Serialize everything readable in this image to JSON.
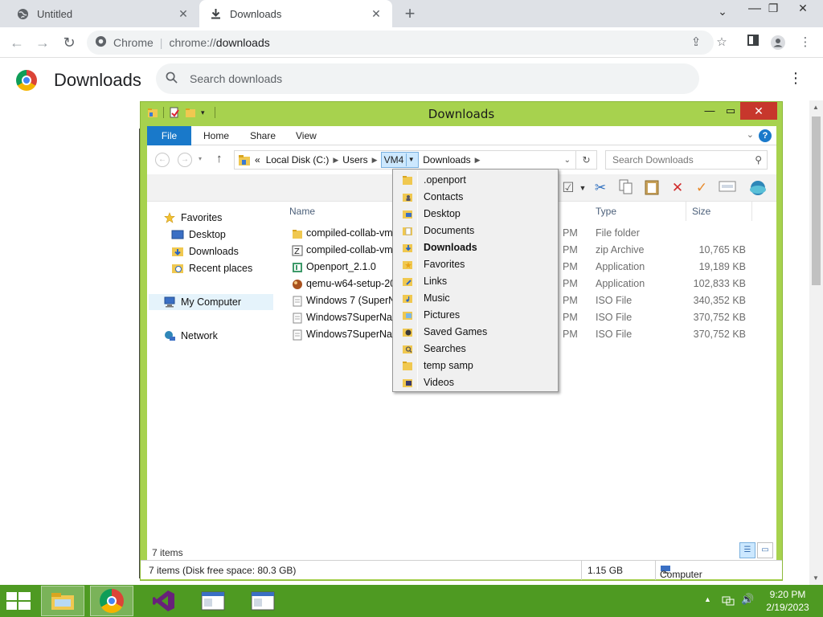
{
  "browser": {
    "tabs": [
      {
        "label": "Untitled",
        "close": "✕"
      },
      {
        "label": "Downloads",
        "close": "✕"
      }
    ],
    "new_tab": "+",
    "window_buttons": {
      "chevron": "⌄",
      "restore": "❐",
      "close": "✕"
    },
    "omnibox": {
      "site": "Chrome",
      "url_prefix": "chrome://",
      "url_host": "downloads"
    }
  },
  "downloads_page": {
    "title": "Downloads",
    "search_placeholder": "Search downloads"
  },
  "explorer": {
    "title": "Downloads",
    "ribbon_tabs": [
      "File",
      "Home",
      "Share",
      "View"
    ],
    "breadcrumb": {
      "prefix": "«",
      "items": [
        "Local Disk (C:)",
        "Users",
        "VM4",
        "Downloads"
      ]
    },
    "search_placeholder": "Search Downloads",
    "nav": {
      "favorites": "Favorites",
      "desktop": "Desktop",
      "downloads": "Downloads",
      "recent": "Recent places",
      "computer": "My Computer",
      "network": "Network"
    },
    "columns": {
      "name": "Name",
      "type": "Type",
      "size": "Size"
    },
    "files": [
      {
        "name": "compiled-collab-vm",
        "date": "PM",
        "type": "File folder",
        "size": ""
      },
      {
        "name": "compiled-collab-vm",
        "date": "PM",
        "type": "zip Archive",
        "size": "10,765 KB"
      },
      {
        "name": "Openport_2.1.0",
        "date": "PM",
        "type": "Application",
        "size": "19,189 KB"
      },
      {
        "name": "qemu-w64-setup-20",
        "date": "PM",
        "type": "Application",
        "size": "102,833 KB"
      },
      {
        "name": "Windows 7 (SuperNa",
        "date": "PM",
        "type": "ISO File",
        "size": "340,352 KB"
      },
      {
        "name": "Windows7SuperNan",
        "date": "PM",
        "type": "ISO File",
        "size": "370,752 KB"
      },
      {
        "name": "Windows7SuperNan",
        "date": "PM",
        "type": "ISO File",
        "size": "370,752 KB"
      }
    ],
    "item_count": "7 items",
    "status": {
      "free_space": "7 items (Disk free space: 80.3 GB)",
      "size": "1.15 GB",
      "location": "Computer"
    },
    "dropdown": [
      ".openport",
      "Contacts",
      "Desktop",
      "Documents",
      "Downloads",
      "Favorites",
      "Links",
      "Music",
      "Pictures",
      "Saved Games",
      "Searches",
      "temp samp",
      "Videos"
    ]
  },
  "taskbar": {
    "time": "9:20 PM",
    "date": "2/19/2023"
  },
  "colors": {
    "explorer_frame": "#a7d24e",
    "taskbar": "#4e9a22",
    "ribbon_file": "#1979ca",
    "close_red": "#c7372c"
  }
}
